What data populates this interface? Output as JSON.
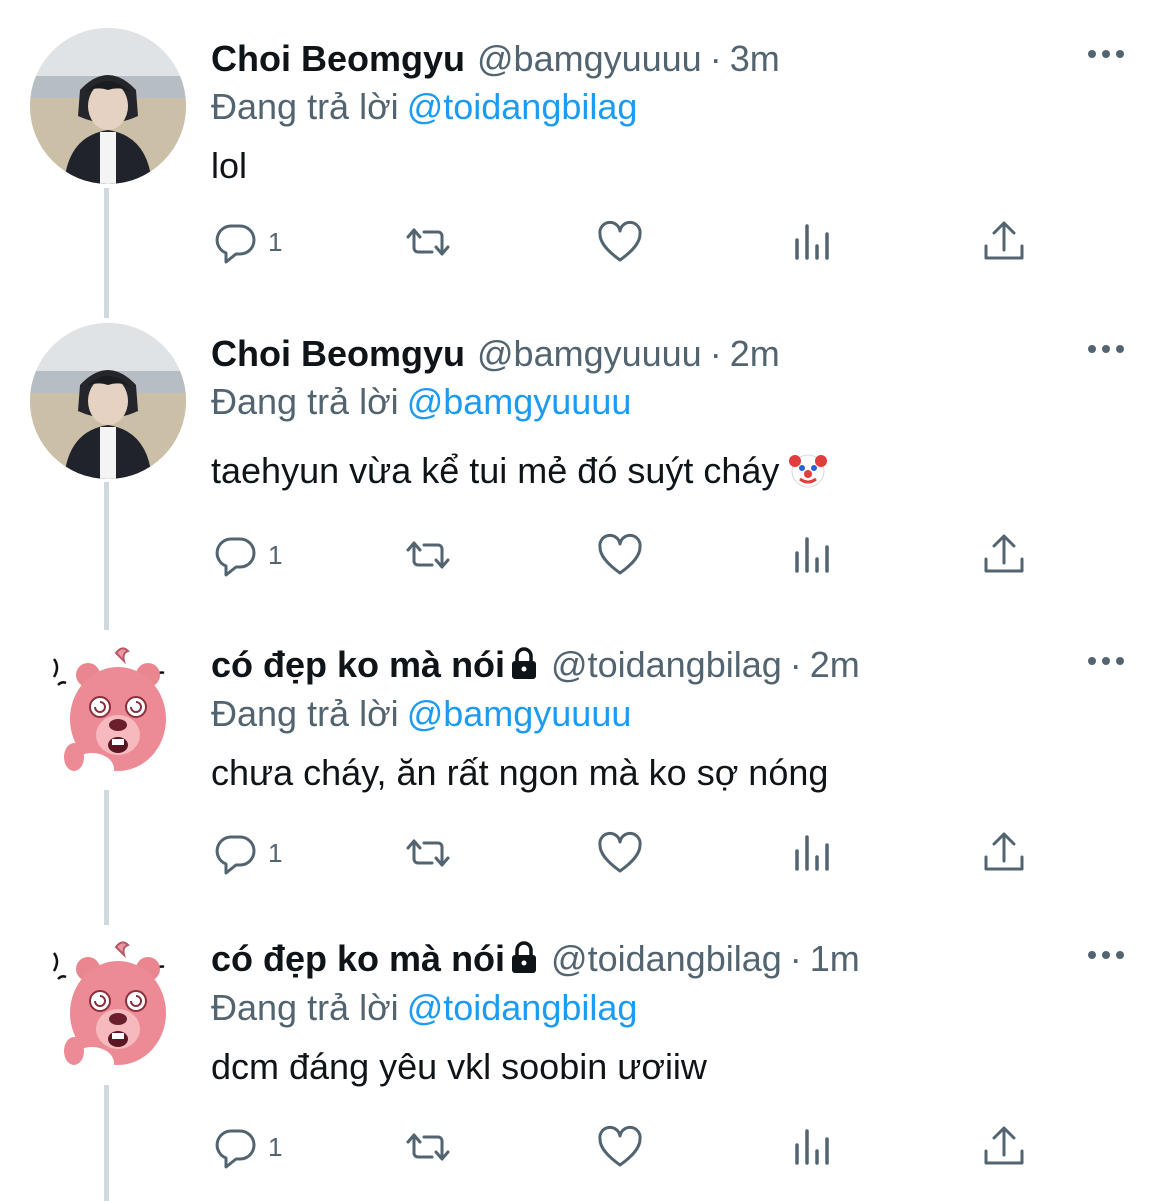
{
  "tweets": [
    {
      "author": "Choi Beomgyu",
      "handle": "@bamgyuuuu",
      "time": "3m",
      "reply_prefix": "Đang trả lời",
      "reply_to": "@toidangbilag",
      "text": "lol",
      "reply_count": "1",
      "avatar": "beomgyu-photo",
      "locked": false,
      "emoji": ""
    },
    {
      "author": "Choi Beomgyu",
      "handle": "@bamgyuuuu",
      "time": "2m",
      "reply_prefix": "Đang trả lời",
      "reply_to": "@bamgyuuuu",
      "text": "taehyun vừa kể tui mẻ đó suýt cháy",
      "reply_count": "1",
      "avatar": "beomgyu-photo",
      "locked": false,
      "emoji": "clown-face-emoji"
    },
    {
      "author": "có đẹp ko mà nói",
      "handle": "@toidangbilag",
      "time": "2m",
      "reply_prefix": "Đang trả lời",
      "reply_to": "@bamgyuuuu",
      "text": "chưa cháy, ăn rất ngon mà ko sợ nóng",
      "reply_count": "1",
      "avatar": "loopy-beaver-cartoon",
      "locked": true,
      "emoji": ""
    },
    {
      "author": "có đẹp ko mà nói",
      "handle": "@toidangbilag",
      "time": "1m",
      "reply_prefix": "Đang trả lời",
      "reply_to": "@toidangbilag",
      "text": "dcm đáng yêu vkl soobin ươiiw",
      "reply_count": "1",
      "avatar": "loopy-beaver-cartoon",
      "locked": true,
      "emoji": ""
    }
  ],
  "dot_separator": "·",
  "colors": {
    "mention": "#1d9bf0",
    "secondary_text": "#536471",
    "primary_text": "#0f1419",
    "thread_line": "#cfd9de"
  },
  "icons": [
    "reply-icon",
    "retweet-icon",
    "like-icon",
    "analytics-icon",
    "share-icon",
    "more-icon",
    "lock-icon"
  ]
}
